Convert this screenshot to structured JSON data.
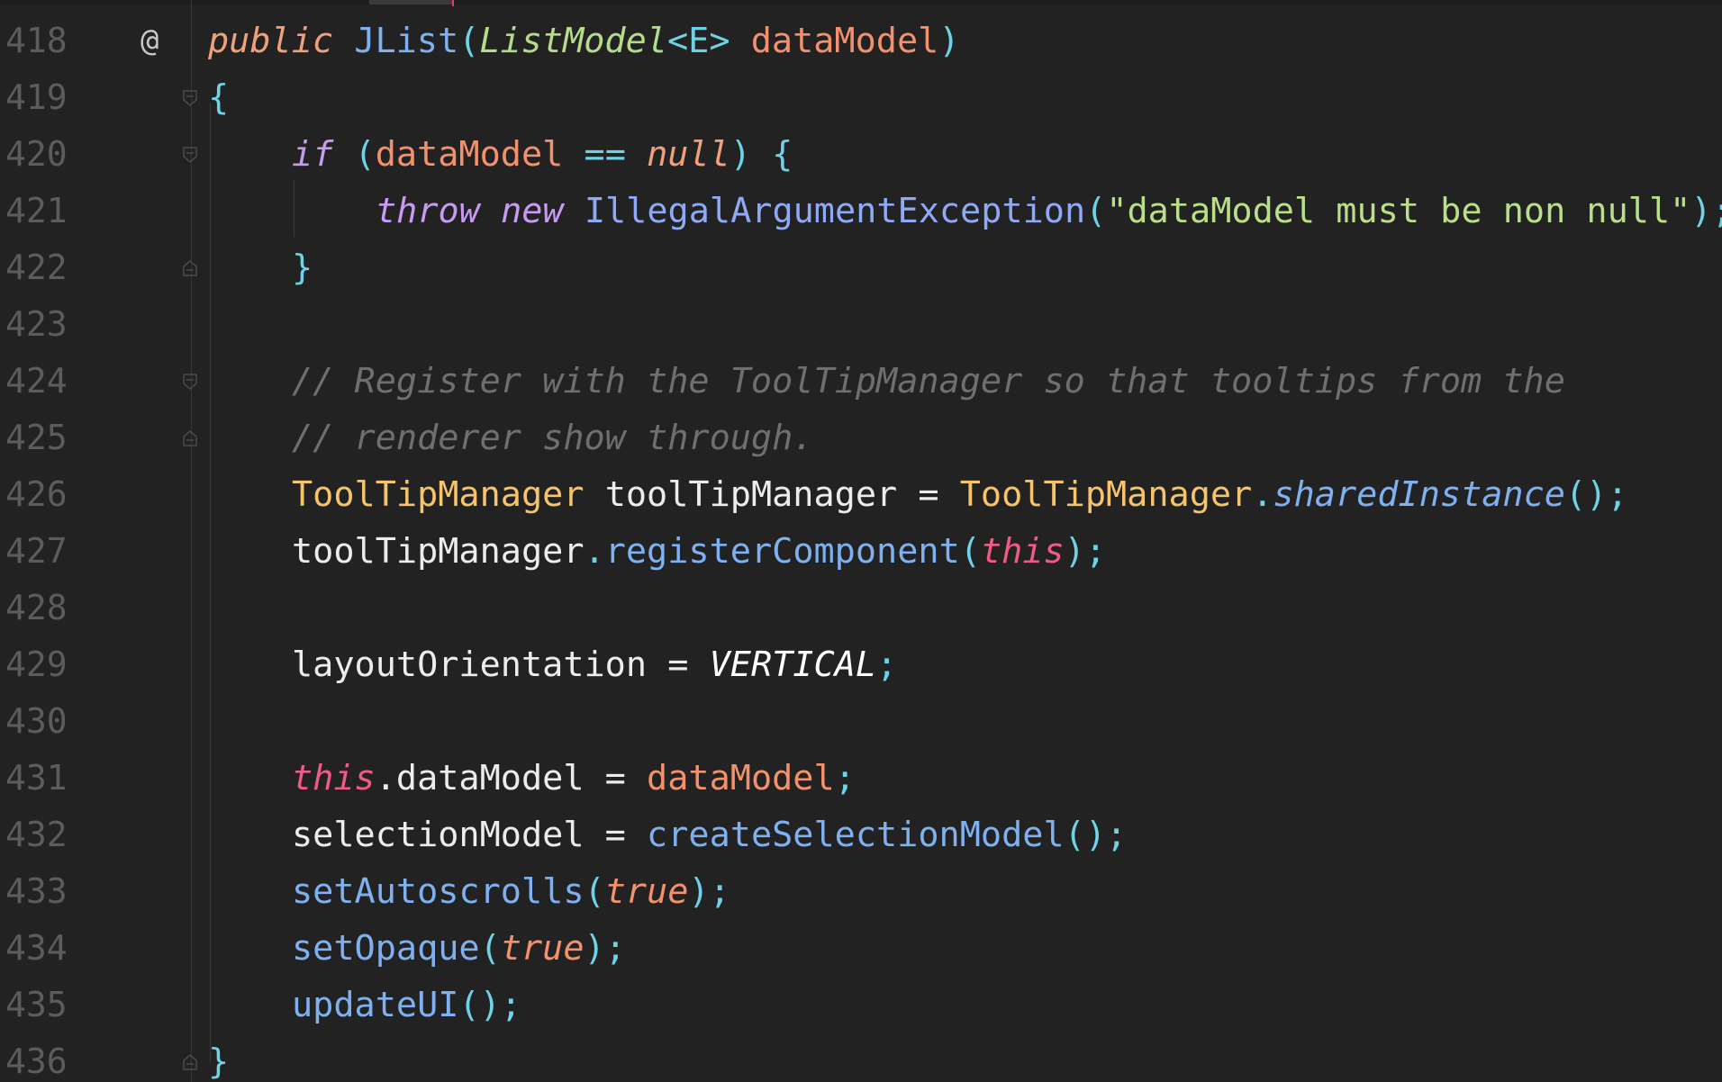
{
  "editor": {
    "gutter_annotation": "@",
    "lines": [
      {
        "num": "418",
        "indent": 0
      },
      {
        "num": "419",
        "indent": 0
      },
      {
        "num": "420",
        "indent": 1
      },
      {
        "num": "421",
        "indent": 2
      },
      {
        "num": "422",
        "indent": 1
      },
      {
        "num": "423",
        "indent": 0
      },
      {
        "num": "424",
        "indent": 1
      },
      {
        "num": "425",
        "indent": 1
      },
      {
        "num": "426",
        "indent": 1
      },
      {
        "num": "427",
        "indent": 1
      },
      {
        "num": "428",
        "indent": 0
      },
      {
        "num": "429",
        "indent": 1
      },
      {
        "num": "430",
        "indent": 0
      },
      {
        "num": "431",
        "indent": 1
      },
      {
        "num": "432",
        "indent": 1
      },
      {
        "num": "433",
        "indent": 1
      },
      {
        "num": "434",
        "indent": 1
      },
      {
        "num": "435",
        "indent": 1
      },
      {
        "num": "436",
        "indent": 0
      }
    ],
    "tokens": {
      "l418": [
        "public",
        " ",
        "JList",
        "(",
        "ListModel",
        "<E>",
        " ",
        "dataModel",
        ")"
      ],
      "l419": [
        "{"
      ],
      "l420": [
        "if",
        " (",
        "dataModel",
        " == ",
        "null",
        ") {"
      ],
      "l421": [
        "throw",
        " ",
        "new",
        " ",
        "IllegalArgumentException",
        "(",
        "\"dataModel must be non null\"",
        ");"
      ],
      "l422": [
        "}"
      ],
      "l424": [
        "// Register with the ToolTipManager so that tooltips from the"
      ],
      "l425": [
        "// renderer show through."
      ],
      "l426": [
        "ToolTipManager",
        " toolTipManager = ",
        "ToolTipManager",
        ".",
        "sharedInstance",
        "();"
      ],
      "l427": [
        "toolTipManager",
        ".",
        "registerComponent",
        "(",
        "this",
        ");"
      ],
      "l429": [
        "layoutOrientation = ",
        "VERTICAL",
        ";"
      ],
      "l431": [
        "this",
        ".dataModel = ",
        "dataModel",
        ";"
      ],
      "l432": [
        "selectionModel = ",
        "createSelectionModel",
        "();"
      ],
      "l433": [
        "setAutoscrolls",
        "(",
        "true",
        ");"
      ],
      "l434": [
        "setOpaque",
        "(",
        "true",
        ");"
      ],
      "l435": [
        "updateUI",
        "();"
      ],
      "l436": [
        "}"
      ]
    },
    "colors": {
      "background": "#222222",
      "keyword": "#c79bf2",
      "modifier": "#f0a07a",
      "function": "#7fb0f0",
      "type_italic": "#b4dc8a",
      "type_class": "#f6c46a",
      "parameter": "#f2916c",
      "punctuation": "#6fd3e8",
      "string": "#b9df8a",
      "comment": "#6f6f6f",
      "this": "#ef5b84"
    }
  }
}
